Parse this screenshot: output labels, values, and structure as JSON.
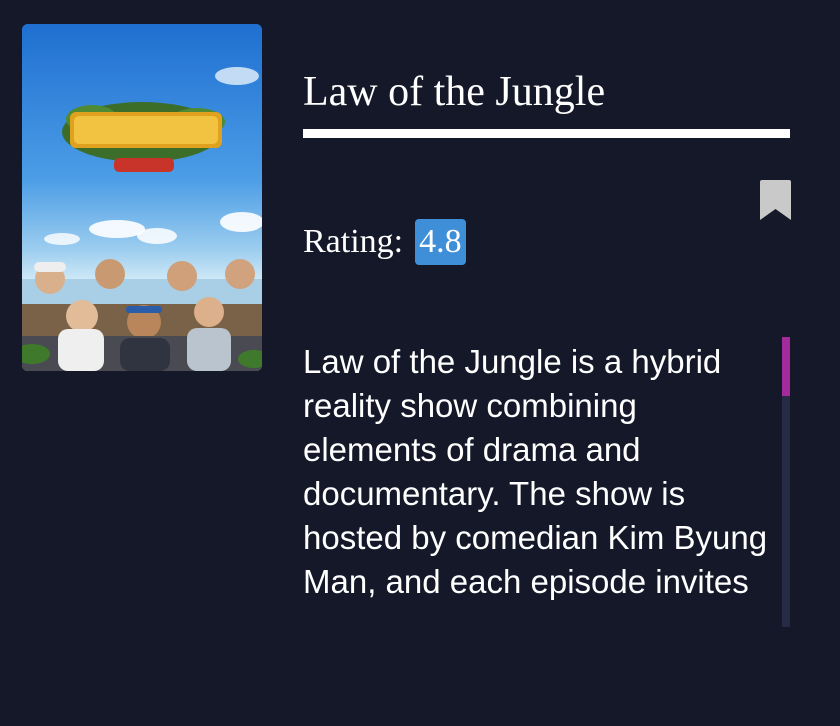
{
  "show": {
    "title": "Law of the Jungle",
    "rating_label": "Rating:",
    "rating_value": "4.8",
    "description": "Law of the Jungle is a hybrid reality show combining elements of drama and documentary. The show is hosted by comedian Kim Byung Man, and each episode invites"
  },
  "colors": {
    "background": "#141829",
    "rating_badge": "#3e8fd8",
    "scroll_thumb": "#a22a9a",
    "scroll_track": "#262b44",
    "bookmark": "#c9c9c9"
  },
  "icons": {
    "bookmark": "bookmark-icon"
  }
}
